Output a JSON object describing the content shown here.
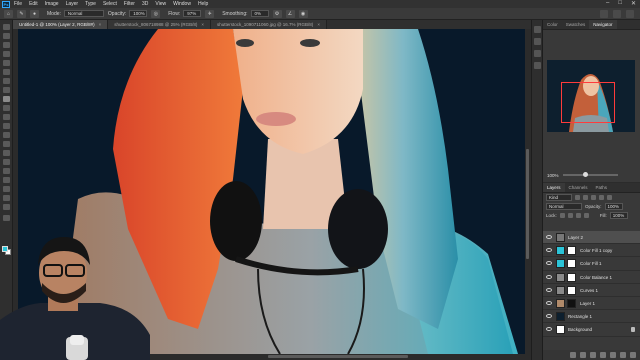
{
  "app": {
    "logo": "Ps",
    "menu": [
      "File",
      "Edit",
      "Image",
      "Layer",
      "Type",
      "Select",
      "Filter",
      "3D",
      "View",
      "Window",
      "Help"
    ],
    "window_controls": [
      "–",
      "□",
      "✕"
    ]
  },
  "options": {
    "mode_label": "Mode:",
    "mode_value": "Normal",
    "opacity_label": "Opacity:",
    "opacity_value": "100%",
    "flow_label": "Flow:",
    "flow_value": "97%",
    "smoothing_label": "Smoothing:",
    "smoothing_value": "0%"
  },
  "tabs": [
    {
      "label": "Untitled-1 @ 100% (Layer 2, RGB/8#)",
      "active": true
    },
    {
      "label": "shutterstock_806718988 @ 25% (RGB/8)",
      "active": false
    },
    {
      "label": "shutterstock_1090711060.jpg @ 16.7% (RGB/8)",
      "active": false
    }
  ],
  "nav_panel": {
    "tabs": [
      "Color",
      "Swatches",
      "Navigator"
    ],
    "active_tab": "Navigator",
    "zoom": "100%"
  },
  "layers_panel": {
    "tabs": [
      "Layers",
      "Channels",
      "Paths"
    ],
    "active_tab": "Layers",
    "kind_label": "Kind",
    "blend_mode": "Normal",
    "opacity_label": "Opacity:",
    "opacity_value": "100%",
    "lock_label": "Lock:",
    "fill_label": "Fill:",
    "fill_value": "100%",
    "layers": [
      {
        "name": "Layer 2",
        "thumb_color": "#777777",
        "mask": false,
        "selected": true
      },
      {
        "name": "Color Fill 1 copy",
        "thumb_color": "#2bc4d8",
        "mask": true,
        "selected": false
      },
      {
        "name": "Color Fill 1",
        "thumb_color": "#2bc4d8",
        "mask": true,
        "selected": false
      },
      {
        "name": "Color Balance 1",
        "thumb_color": "#8a8a8a",
        "mask": true,
        "selected": false
      },
      {
        "name": "Curves 1",
        "thumb_color": "#8a8a8a",
        "mask": true,
        "selected": false
      },
      {
        "name": "Layer 1",
        "thumb_color": "#b08a6a",
        "mask": true,
        "selected": false
      },
      {
        "name": "Rectangle 1",
        "thumb_color": "#0d1f2e",
        "mask": false,
        "selected": false
      },
      {
        "name": "Background",
        "thumb_color": "#ffffff",
        "mask": false,
        "selected": false,
        "locked": true
      }
    ]
  },
  "colors": {
    "foreground": "#2bc4d8",
    "background": "#ffffff",
    "accent": "#31a8ff"
  }
}
